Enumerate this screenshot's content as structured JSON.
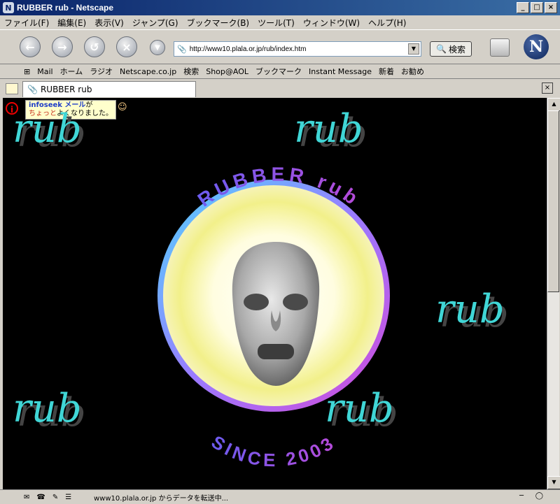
{
  "window": {
    "title": "RUBBER rub - Netscape",
    "minimize": "_",
    "maximize": "□",
    "close": "×"
  },
  "menu": [
    "ファイル(F)",
    "編集(E)",
    "表示(V)",
    "ジャンプ(G)",
    "ブックマーク(B)",
    "ツール(T)",
    "ウィンドウ(W)",
    "ヘルプ(H)"
  ],
  "toolbar": {
    "url": "http://www10.plala.or.jp/rub/index.htm",
    "search_label": "検索",
    "logo_letter": "N"
  },
  "personal_toolbar": [
    "Mail",
    "ホーム",
    "ラジオ",
    "Netscape.co.jp",
    "検索",
    "Shop@AOL",
    "ブックマーク",
    "Instant Message",
    "新着",
    "お勧め"
  ],
  "tab": {
    "title": "RUBBER rub"
  },
  "page": {
    "banner_line1a": "infoseek",
    "banner_line1b": " メール",
    "banner_line1c": "が",
    "banner_line2a": "ちょっと",
    "banner_line2b": "よくなりました。",
    "rub_word": "rub",
    "arc_top": "RUBBER rub",
    "arc_bottom": "SINCE 2003"
  },
  "status": {
    "text": "www10.plala.or.jp からデータを転送中..."
  },
  "colors": {
    "title_start": "#0a246a",
    "rub_cyan": "#40d6d6",
    "arc_purple": "#7a3ad8"
  }
}
